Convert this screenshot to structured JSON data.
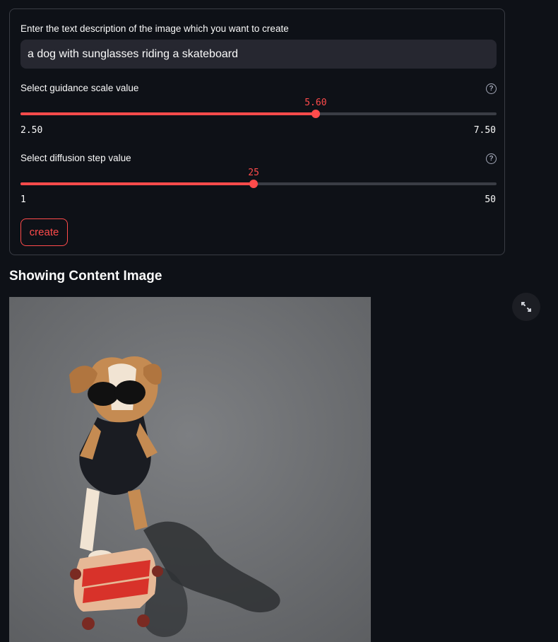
{
  "form": {
    "prompt_label": "Enter the text description of the image which you want to create",
    "prompt_value": "a dog with sunglasses riding a skateboard",
    "guidance": {
      "label": "Select guidance scale value",
      "value": 5.6,
      "value_text": "5.60",
      "min": 2.5,
      "max": 7.5,
      "min_text": "2.50",
      "max_text": "7.50"
    },
    "steps": {
      "label": "Select diffusion step value",
      "value": 25,
      "value_text": "25",
      "min": 1,
      "max": 50,
      "min_text": "1",
      "max_text": "50"
    },
    "create_label": "create"
  },
  "output": {
    "heading": "Showing Content Image"
  },
  "icons": {
    "help": "help-circle-icon",
    "fullscreen": "expand-icon"
  },
  "colors": {
    "accent": "#ff4b4b",
    "background": "#0e1117",
    "input_bg": "#262730"
  }
}
